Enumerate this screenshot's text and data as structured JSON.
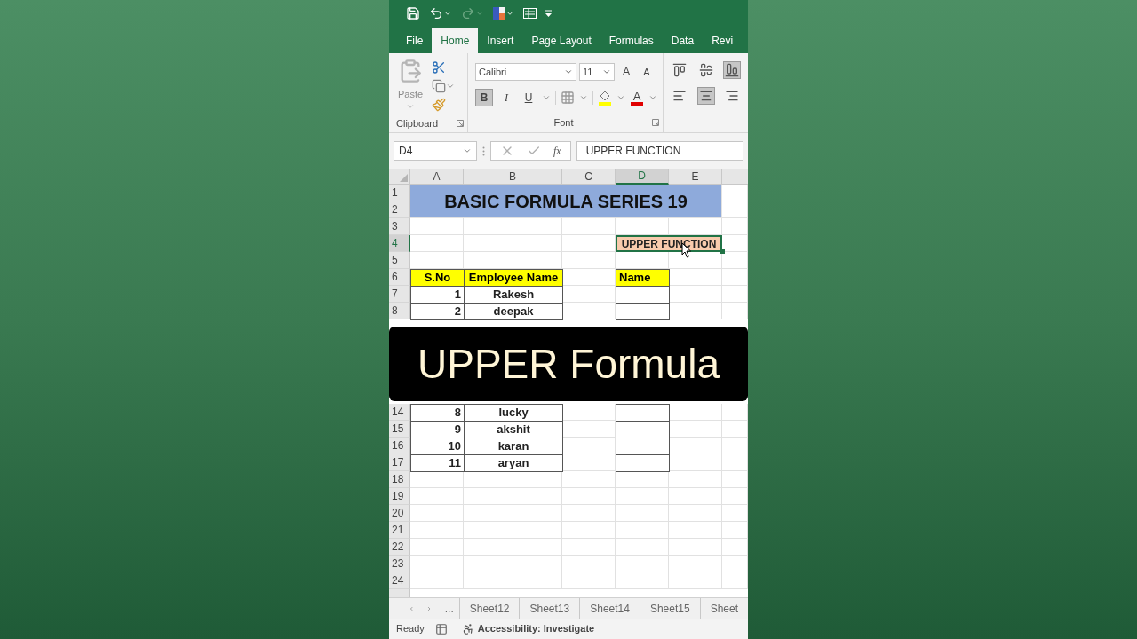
{
  "quick_access": {
    "items": [
      {
        "kind": "save"
      },
      {
        "kind": "undo"
      },
      {
        "kind": "redo"
      },
      {
        "kind": "color"
      },
      {
        "kind": "form"
      },
      {
        "kind": "customize"
      }
    ]
  },
  "tabs": [
    {
      "label": "File",
      "selected": false
    },
    {
      "label": "Home",
      "selected": true
    },
    {
      "label": "Insert",
      "selected": false
    },
    {
      "label": "Page Layout",
      "selected": false
    },
    {
      "label": "Formulas",
      "selected": false
    },
    {
      "label": "Data",
      "selected": false
    },
    {
      "label": "Revi",
      "selected": false
    }
  ],
  "ribbon": {
    "clipboard": {
      "paste_label": "Paste",
      "group_label": "Clipboard"
    },
    "font": {
      "name": "Calibri",
      "size": "11",
      "group_label": "Font",
      "size_buttons": [
        {
          "label": "A",
          "kind": "grow"
        },
        {
          "label": "A",
          "kind": "shrink"
        }
      ],
      "style_buttons": [
        {
          "label": "B",
          "kind": "bold",
          "selected": true
        },
        {
          "label": "I",
          "kind": "italic",
          "selected": false
        },
        {
          "label": "U",
          "kind": "underline",
          "selected": false
        }
      ],
      "font_color_label": "A"
    },
    "alignment": [
      {
        "kind": "top",
        "selected": false
      },
      {
        "kind": "middle",
        "selected": false
      },
      {
        "kind": "bottom",
        "selected": true
      },
      {
        "kind": "left",
        "selected": false
      },
      {
        "kind": "center",
        "selected": true
      },
      {
        "kind": "right",
        "selected": false
      }
    ]
  },
  "formula_bar": {
    "name_box": "D4",
    "function_symbol": "fx",
    "formula": "UPPER FUNCTION"
  },
  "sheet": {
    "columns": [
      {
        "label": "A",
        "selected": false
      },
      {
        "label": "B",
        "selected": false
      },
      {
        "label": "C",
        "selected": false
      },
      {
        "label": "D",
        "selected": true
      },
      {
        "label": "E",
        "selected": false
      }
    ],
    "rows": [
      {
        "label": "1",
        "selected": false
      },
      {
        "label": "2",
        "selected": false
      },
      {
        "label": "3",
        "selected": false
      },
      {
        "label": "4",
        "selected": true
      },
      {
        "label": "5",
        "selected": false
      },
      {
        "label": "6",
        "selected": false
      },
      {
        "label": "7",
        "selected": false,
        "sno": "1",
        "employee": "Rakesh"
      },
      {
        "label": "8",
        "selected": false,
        "sno": "2",
        "employee": "deepak"
      },
      {
        "label": "14",
        "selected": false,
        "sno": "8",
        "employee": "lucky"
      },
      {
        "label": "15",
        "selected": false,
        "sno": "9",
        "employee": "akshit"
      },
      {
        "label": "16",
        "selected": false,
        "sno": "10",
        "employee": "karan"
      },
      {
        "label": "17",
        "selected": false,
        "sno": "11",
        "employee": "aryan"
      },
      {
        "label": "18",
        "selected": false
      },
      {
        "label": "19",
        "selected": false
      },
      {
        "label": "20",
        "selected": false
      },
      {
        "label": "21",
        "selected": false
      },
      {
        "label": "22",
        "selected": false
      },
      {
        "label": "23",
        "selected": false
      },
      {
        "label": "24",
        "selected": false
      }
    ],
    "title": "BASIC FORMULA SERIES 19",
    "label_cell": {
      "text": "UPPER FUNCTION",
      "selected": true
    },
    "table": {
      "headers": [
        "S.No",
        "Employee Name"
      ]
    },
    "name_column": {
      "header": "Name"
    }
  },
  "sheet_tabs": {
    "more": "...",
    "tabs": [
      {
        "label": "Sheet12",
        "selected": false
      },
      {
        "label": "Sheet13",
        "selected": false
      },
      {
        "label": "Sheet14",
        "selected": false
      },
      {
        "label": "Sheet15",
        "selected": false
      },
      {
        "label": "Sheet",
        "selected": false
      }
    ]
  },
  "status_bar": {
    "mode": "Ready",
    "accessibility": "Accessibility: Investigate"
  },
  "banner": {
    "text": "UPPER Formula"
  }
}
